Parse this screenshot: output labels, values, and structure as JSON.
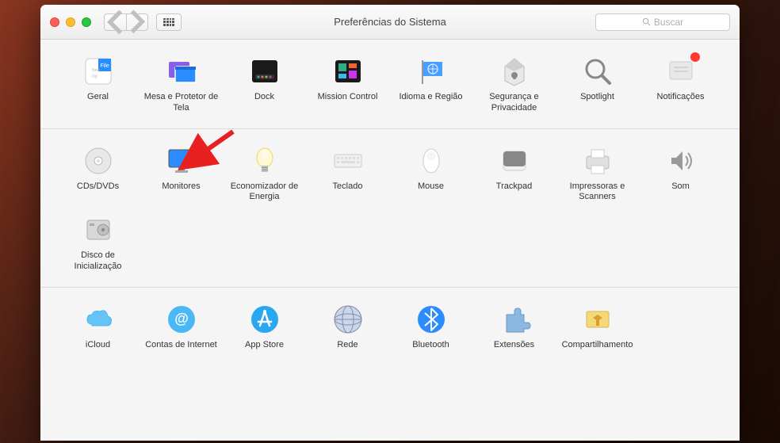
{
  "window": {
    "title": "Preferências do Sistema",
    "search_placeholder": "Buscar"
  },
  "sections": [
    {
      "items": [
        {
          "label": "Geral",
          "icon": "general-icon"
        },
        {
          "label": "Mesa e Protetor de Tela",
          "icon": "desktop-icon"
        },
        {
          "label": "Dock",
          "icon": "dock-icon"
        },
        {
          "label": "Mission Control",
          "icon": "mission-control-icon"
        },
        {
          "label": "Idioma e Região",
          "icon": "language-icon"
        },
        {
          "label": "Segurança e Privacidade",
          "icon": "security-icon"
        },
        {
          "label": "Spotlight",
          "icon": "spotlight-icon"
        },
        {
          "label": "Notificações",
          "icon": "notifications-icon",
          "badge": true
        }
      ]
    },
    {
      "items": [
        {
          "label": "CDs/DVDs",
          "icon": "disc-icon"
        },
        {
          "label": "Monitores",
          "icon": "displays-icon"
        },
        {
          "label": "Economizador de Energia",
          "icon": "energy-icon"
        },
        {
          "label": "Teclado",
          "icon": "keyboard-icon"
        },
        {
          "label": "Mouse",
          "icon": "mouse-icon"
        },
        {
          "label": "Trackpad",
          "icon": "trackpad-icon"
        },
        {
          "label": "Impressoras e Scanners",
          "icon": "printers-icon"
        },
        {
          "label": "Som",
          "icon": "sound-icon"
        }
      ]
    },
    {
      "items": [
        {
          "label": "Disco de Inicialização",
          "icon": "startup-disk-icon"
        }
      ]
    },
    {
      "items": [
        {
          "label": "iCloud",
          "icon": "icloud-icon"
        },
        {
          "label": "Contas de Internet",
          "icon": "accounts-icon"
        },
        {
          "label": "App Store",
          "icon": "appstore-icon"
        },
        {
          "label": "Rede",
          "icon": "network-icon"
        },
        {
          "label": "Bluetooth",
          "icon": "bluetooth-icon"
        },
        {
          "label": "Extensões",
          "icon": "extensions-icon"
        },
        {
          "label": "Compartilhamento",
          "icon": "sharing-icon"
        }
      ]
    }
  ],
  "annotation": {
    "arrow_target": "Monitores"
  }
}
